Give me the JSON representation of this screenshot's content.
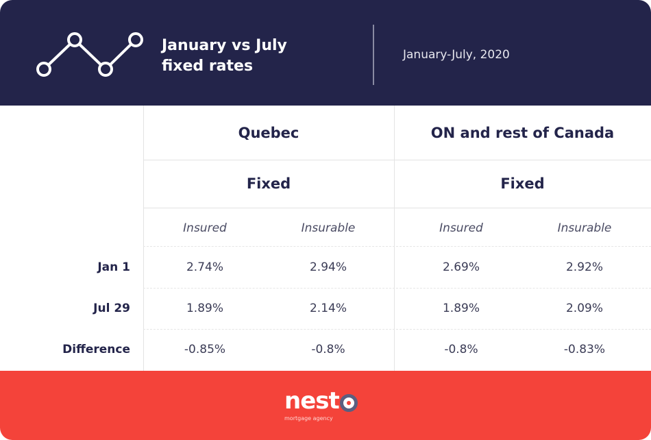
{
  "header": {
    "title": "January vs July fixed rates",
    "period": "January-July, 2020",
    "icon": "line-chart-icon"
  },
  "table": {
    "regions": [
      "Quebec",
      "ON and rest of Canada"
    ],
    "rate_type": "Fixed",
    "sub_columns": [
      "Insured",
      "Insurable"
    ],
    "rows": [
      {
        "label": "Jan 1",
        "values": [
          "2.74%",
          "2.94%",
          "2.69%",
          "2.92%"
        ]
      },
      {
        "label": "Jul 29",
        "values": [
          "1.89%",
          "2.14%",
          "1.89%",
          "2.09%"
        ]
      },
      {
        "label": "Difference",
        "values": [
          "-0.85%",
          "-0.8%",
          "-0.8%",
          "-0.83%"
        ]
      }
    ]
  },
  "footer": {
    "brand": "nest",
    "brand_tagline": "mortgage agency"
  },
  "colors": {
    "navy": "#23244a",
    "red": "#f4433a"
  }
}
